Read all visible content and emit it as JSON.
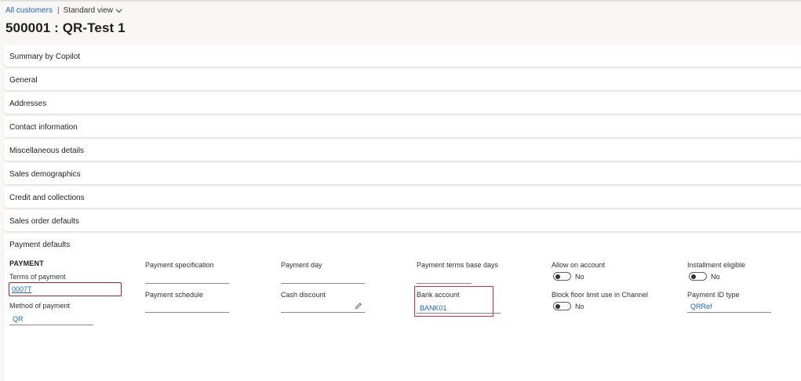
{
  "breadcrumb": {
    "link": "All customers",
    "separator": "|",
    "view": "Standard view"
  },
  "page_title": "500001 : QR-Test 1",
  "fasttabs": [
    "Summary by Copilot",
    "General",
    "Addresses",
    "Contact information",
    "Miscellaneous details",
    "Sales demographics",
    "Credit and collections",
    "Sales order defaults"
  ],
  "payment": {
    "title": "Payment defaults",
    "group_heading": "PAYMENT",
    "terms_of_payment": {
      "label": "Terms of payment",
      "value": "0007T"
    },
    "method_of_payment": {
      "label": "Method of payment",
      "value": "QR"
    },
    "payment_specification": {
      "label": "Payment specification",
      "value": ""
    },
    "payment_schedule": {
      "label": "Payment schedule",
      "value": ""
    },
    "payment_day": {
      "label": "Payment day",
      "value": ""
    },
    "cash_discount": {
      "label": "Cash discount",
      "value": ""
    },
    "payment_terms_base_days": {
      "label": "Payment terms base days",
      "value": ""
    },
    "bank_account": {
      "label": "Bank account",
      "value": "BANK01"
    },
    "allow_on_account": {
      "label": "Allow on account",
      "state": "No"
    },
    "block_floor_limit": {
      "label": "Block floor limit use in Channel",
      "state": "No"
    },
    "installment_eligible": {
      "label": "Installment eligible",
      "state": "No"
    },
    "payment_id_type": {
      "label": "Payment ID type",
      "value": "QRRef"
    }
  },
  "colors": {
    "link": "#2266b0",
    "highlight": "#d13438",
    "invalid_border": "#a4262c"
  },
  "icons": {
    "view_chevron": "chevron-down-icon",
    "cash_discount_edit": "pencil-icon"
  }
}
